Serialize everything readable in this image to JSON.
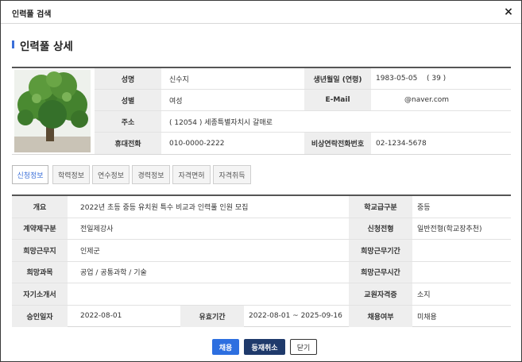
{
  "window": {
    "title": "인력풀 검색",
    "close_glyph": "×"
  },
  "section_title": "인력풀 상세",
  "profile": {
    "name_label": "성명",
    "name": "신수지",
    "birth_label": "생년월일 (연령)",
    "birth": "1983-05-05",
    "age": "( 39 )",
    "gender_label": "성별",
    "gender": "여성",
    "email_label": "E-Mail",
    "email": "@naver.com",
    "address_label": "주소",
    "address": "( 12054 ) 세종특별자치시 갈매로",
    "phone_label": "휴대전화",
    "phone": "010-0000-2222",
    "emergency_label": "비상연락전화번호",
    "emergency": "02-1234-5678"
  },
  "tabs": [
    {
      "label": "신청정보",
      "active": true
    },
    {
      "label": "학력정보",
      "active": false
    },
    {
      "label": "연수정보",
      "active": false
    },
    {
      "label": "경력정보",
      "active": false
    },
    {
      "label": "자격면허",
      "active": false
    },
    {
      "label": "자격취득",
      "active": false
    }
  ],
  "detail": {
    "overview_label": "개요",
    "overview": "2022년 초등 중등 유치원 특수 비교과 인력풀 인원 모집",
    "school_level_label": "학교급구분",
    "school_level": "중등",
    "contract_label": "계약제구분",
    "contract": "전일제강사",
    "apply_type_label": "신청전형",
    "apply_type": "일반전형(학교장추천)",
    "region_label": "희망근무지",
    "region": "인제군",
    "period_label": "희망근무기간",
    "period": "",
    "subject_label": "희망과목",
    "subject": "공업 / 공통과학 / 기술",
    "hours_label": "희망근무시간",
    "hours": "",
    "intro_label": "자기소개서",
    "intro": "",
    "license_label": "교원자격증",
    "license": "소지",
    "approve_label": "승인일자",
    "approve": "2022-08-01",
    "valid_label": "유효기간",
    "valid": "2022-08-01 ~ 2025-09-16",
    "hire_label": "채용여부",
    "hire": "미채용"
  },
  "buttons": {
    "adopt": "채용",
    "cancel": "등재취소",
    "close": "닫기"
  },
  "colors": {
    "accent": "#2d6fe0",
    "dark_button": "#1f3a6b",
    "label_bg": "#eeeeee",
    "tab_active": "#3b6fd8"
  }
}
